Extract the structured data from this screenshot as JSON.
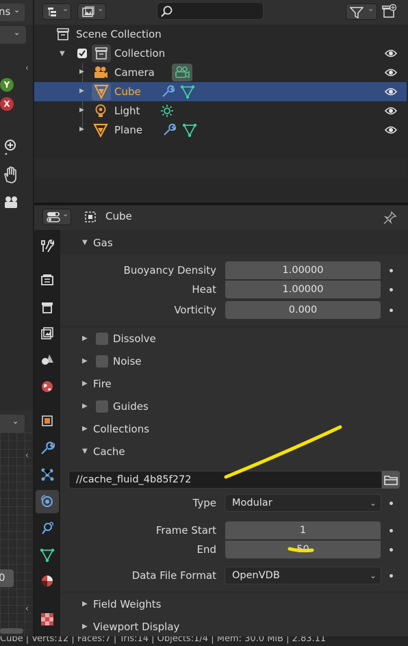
{
  "viewport": {
    "mode_label": "ns",
    "axis_y": "Y",
    "axis_x": "X",
    "bottom_value": "0",
    "colors": {
      "axis_y": "#4e8a2e",
      "axis_x": "#c2333a"
    }
  },
  "outliner": {
    "search_placeholder": "",
    "scene_collection": "Scene Collection",
    "items": [
      {
        "label": "Collection",
        "icon": "collection-icon"
      },
      {
        "label": "Camera",
        "icon": "camera-icon"
      },
      {
        "label": "Cube",
        "icon": "mesh-icon",
        "selected": true
      },
      {
        "label": "Light",
        "icon": "light-icon"
      },
      {
        "label": "Plane",
        "icon": "mesh-icon"
      }
    ]
  },
  "properties": {
    "object_name": "Cube",
    "panels": {
      "gas": "Gas",
      "dissolve": "Dissolve",
      "noise": "Noise",
      "fire": "Fire",
      "guides": "Guides",
      "collections": "Collections",
      "cache": "Cache",
      "field_weights": "Field Weights",
      "viewport_display": "Viewport Display"
    },
    "gas_fields": [
      {
        "label": "Buoyancy Density",
        "value": "1.00000"
      },
      {
        "label": "Heat",
        "value": "1.00000"
      },
      {
        "label": "Vorticity",
        "value": "0.000"
      }
    ],
    "cache": {
      "directory": "//cache_fluid_4b85f272",
      "type_label": "Type",
      "type_value": "Modular",
      "frame_start_label": "Frame Start",
      "frame_start_value": "1",
      "end_label": "End",
      "end_value": "50",
      "data_format_label": "Data File Format",
      "data_format_value": "OpenVDB"
    }
  },
  "statusbar": {
    "text": "Cube | Verts:12 | Faces:7 | Tris:14 | Objects:1/4 | Mem: 30.0 MiB | 2.83.11"
  },
  "accent": {
    "selected_row": "#334d80",
    "highlight_text": "#ffaf29",
    "annotation": "#f6e400"
  }
}
